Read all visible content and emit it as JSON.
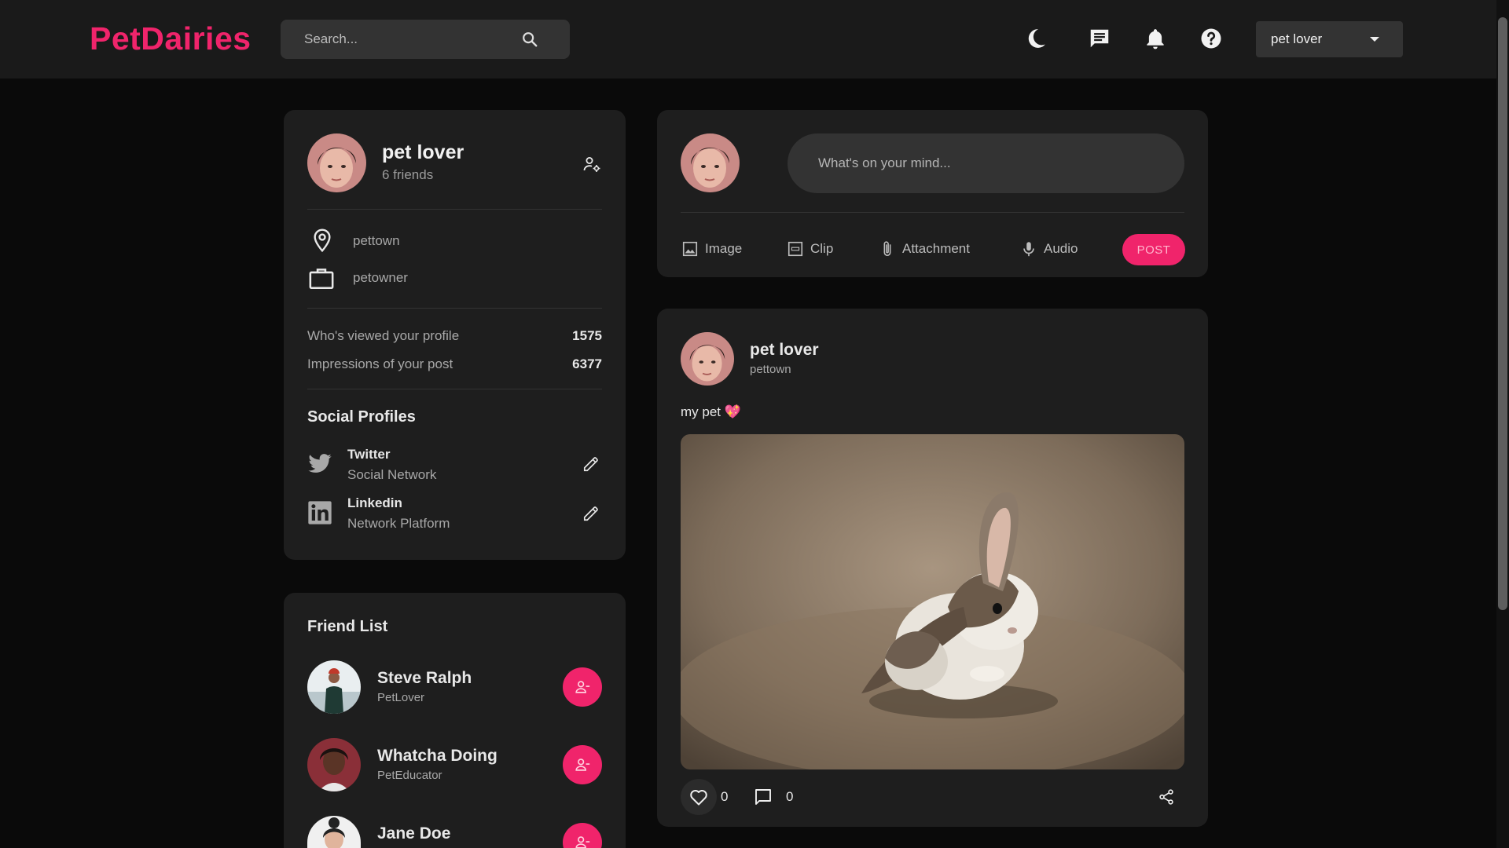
{
  "app": {
    "logo": "PetDairies"
  },
  "search": {
    "placeholder": "Search..."
  },
  "nav": {
    "icons": [
      "moon-icon",
      "chat-icon",
      "bell-icon",
      "help-icon"
    ],
    "user_select": "pet lover"
  },
  "profile": {
    "name": "pet lover",
    "friends": "6 friends",
    "location": "pettown",
    "occupation": "petowner",
    "stats": [
      {
        "label": "Who's viewed your profile",
        "value": "1575"
      },
      {
        "label": "Impressions of your post",
        "value": "6377"
      }
    ],
    "social_title": "Social Profiles",
    "socials": [
      {
        "name": "Twitter",
        "desc": "Social Network"
      },
      {
        "name": "Linkedin",
        "desc": "Network Platform"
      }
    ]
  },
  "friends": {
    "title": "Friend List",
    "items": [
      {
        "name": "Steve Ralph",
        "role": "PetLover"
      },
      {
        "name": "Whatcha Doing",
        "role": "PetEducator"
      },
      {
        "name": "Jane Doe",
        "role": ""
      }
    ]
  },
  "composer": {
    "placeholder": "What's on your mind...",
    "tools": [
      "Image",
      "Clip",
      "Attachment",
      "Audio"
    ],
    "post_label": "POST"
  },
  "post": {
    "name": "pet lover",
    "location": "pettown",
    "text": "my pet 💖",
    "likes": "0",
    "comments": "0"
  },
  "colors": {
    "accent": "#f0246b",
    "background": "#0a0a0a",
    "card": "#1e1e1e",
    "nav": "#1a1a1a"
  }
}
